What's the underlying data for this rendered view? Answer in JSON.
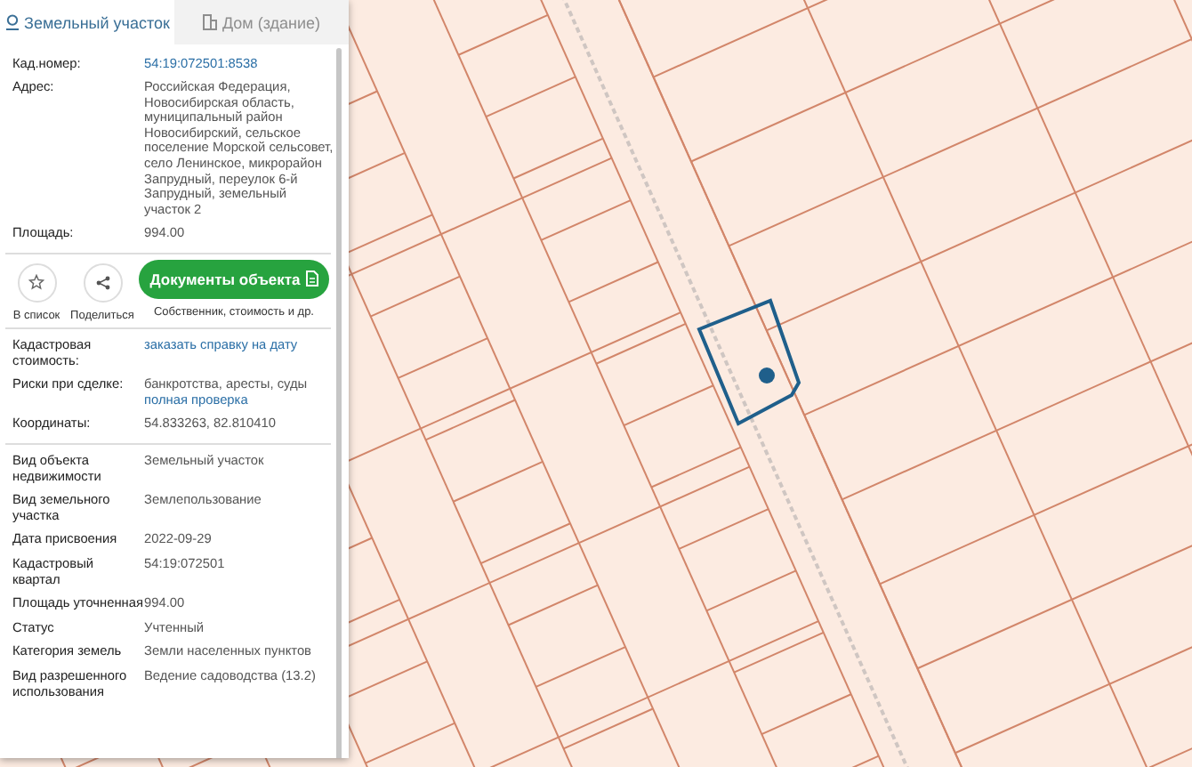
{
  "tabs": [
    {
      "label": "Земельный участок",
      "selected": true,
      "disabled": false
    },
    {
      "label": "Дом (здание)",
      "selected": false,
      "disabled": true
    }
  ],
  "summary": [
    {
      "label": "Кад.номер:",
      "lines": [
        {
          "text": "54:19:072501:8538",
          "kind": "link"
        }
      ]
    },
    {
      "label": "Адрес:",
      "lines": [
        {
          "text": "Российская Федерация, Новосибирская область, муниципальный район Новосибирский, сельское поселение Морской сельсовет, село Ленинское, микрорайон Запрудный, переулок 6-й Запрудный, земельный участок 2",
          "kind": "text"
        }
      ]
    },
    {
      "label": "Площадь:",
      "lines": [
        {
          "text": "994.00",
          "kind": "text"
        }
      ]
    }
  ],
  "actions": {
    "buttons": [
      {
        "label": "В список",
        "kind": "star"
      },
      {
        "label": "Поделиться",
        "kind": "share"
      }
    ],
    "primary": {
      "label": "Документы объекта",
      "caption": "Собственник, стоимость и др."
    }
  },
  "info": [
    {
      "label": "Кадастровая стоимость:",
      "lines": [
        {
          "text": "заказать справку на дату",
          "kind": "link"
        }
      ]
    },
    {
      "label": "Риски при сделке:",
      "lines": [
        {
          "text": "банкротства, аресты, суды",
          "kind": "text"
        },
        {
          "text": "полная проверка",
          "kind": "link"
        }
      ]
    },
    {
      "label": "Координаты:",
      "lines": [
        {
          "text": "54.833263, 82.810410",
          "kind": "text"
        }
      ]
    }
  ],
  "details": [
    {
      "label": "Вид объекта недвижимости",
      "lines": [
        {
          "text": "Земельный участок",
          "kind": "text"
        }
      ]
    },
    {
      "label": "Вид земельного участка",
      "lines": [
        {
          "text": "Землепользование",
          "kind": "text"
        }
      ]
    },
    {
      "label": "Дата присвоения",
      "lines": [
        {
          "text": "2022-09-29",
          "kind": "text"
        }
      ]
    },
    {
      "label": "Кадастровый квартал",
      "lines": [
        {
          "text": "54:19:072501",
          "kind": "text"
        }
      ]
    },
    {
      "label": "Площадь уточненная",
      "lines": [
        {
          "text": "994.00",
          "kind": "text"
        }
      ]
    },
    {
      "label": "Статус",
      "lines": [
        {
          "text": "Учтенный",
          "kind": "text"
        }
      ]
    },
    {
      "label": "Категория земель",
      "lines": [
        {
          "text": "Земли населенных пунктов",
          "kind": "text"
        }
      ]
    },
    {
      "label": "Вид разрешенного использования",
      "lines": [
        {
          "text": "Ведение садоводства (13.2)",
          "kind": "text"
        }
      ]
    }
  ]
}
